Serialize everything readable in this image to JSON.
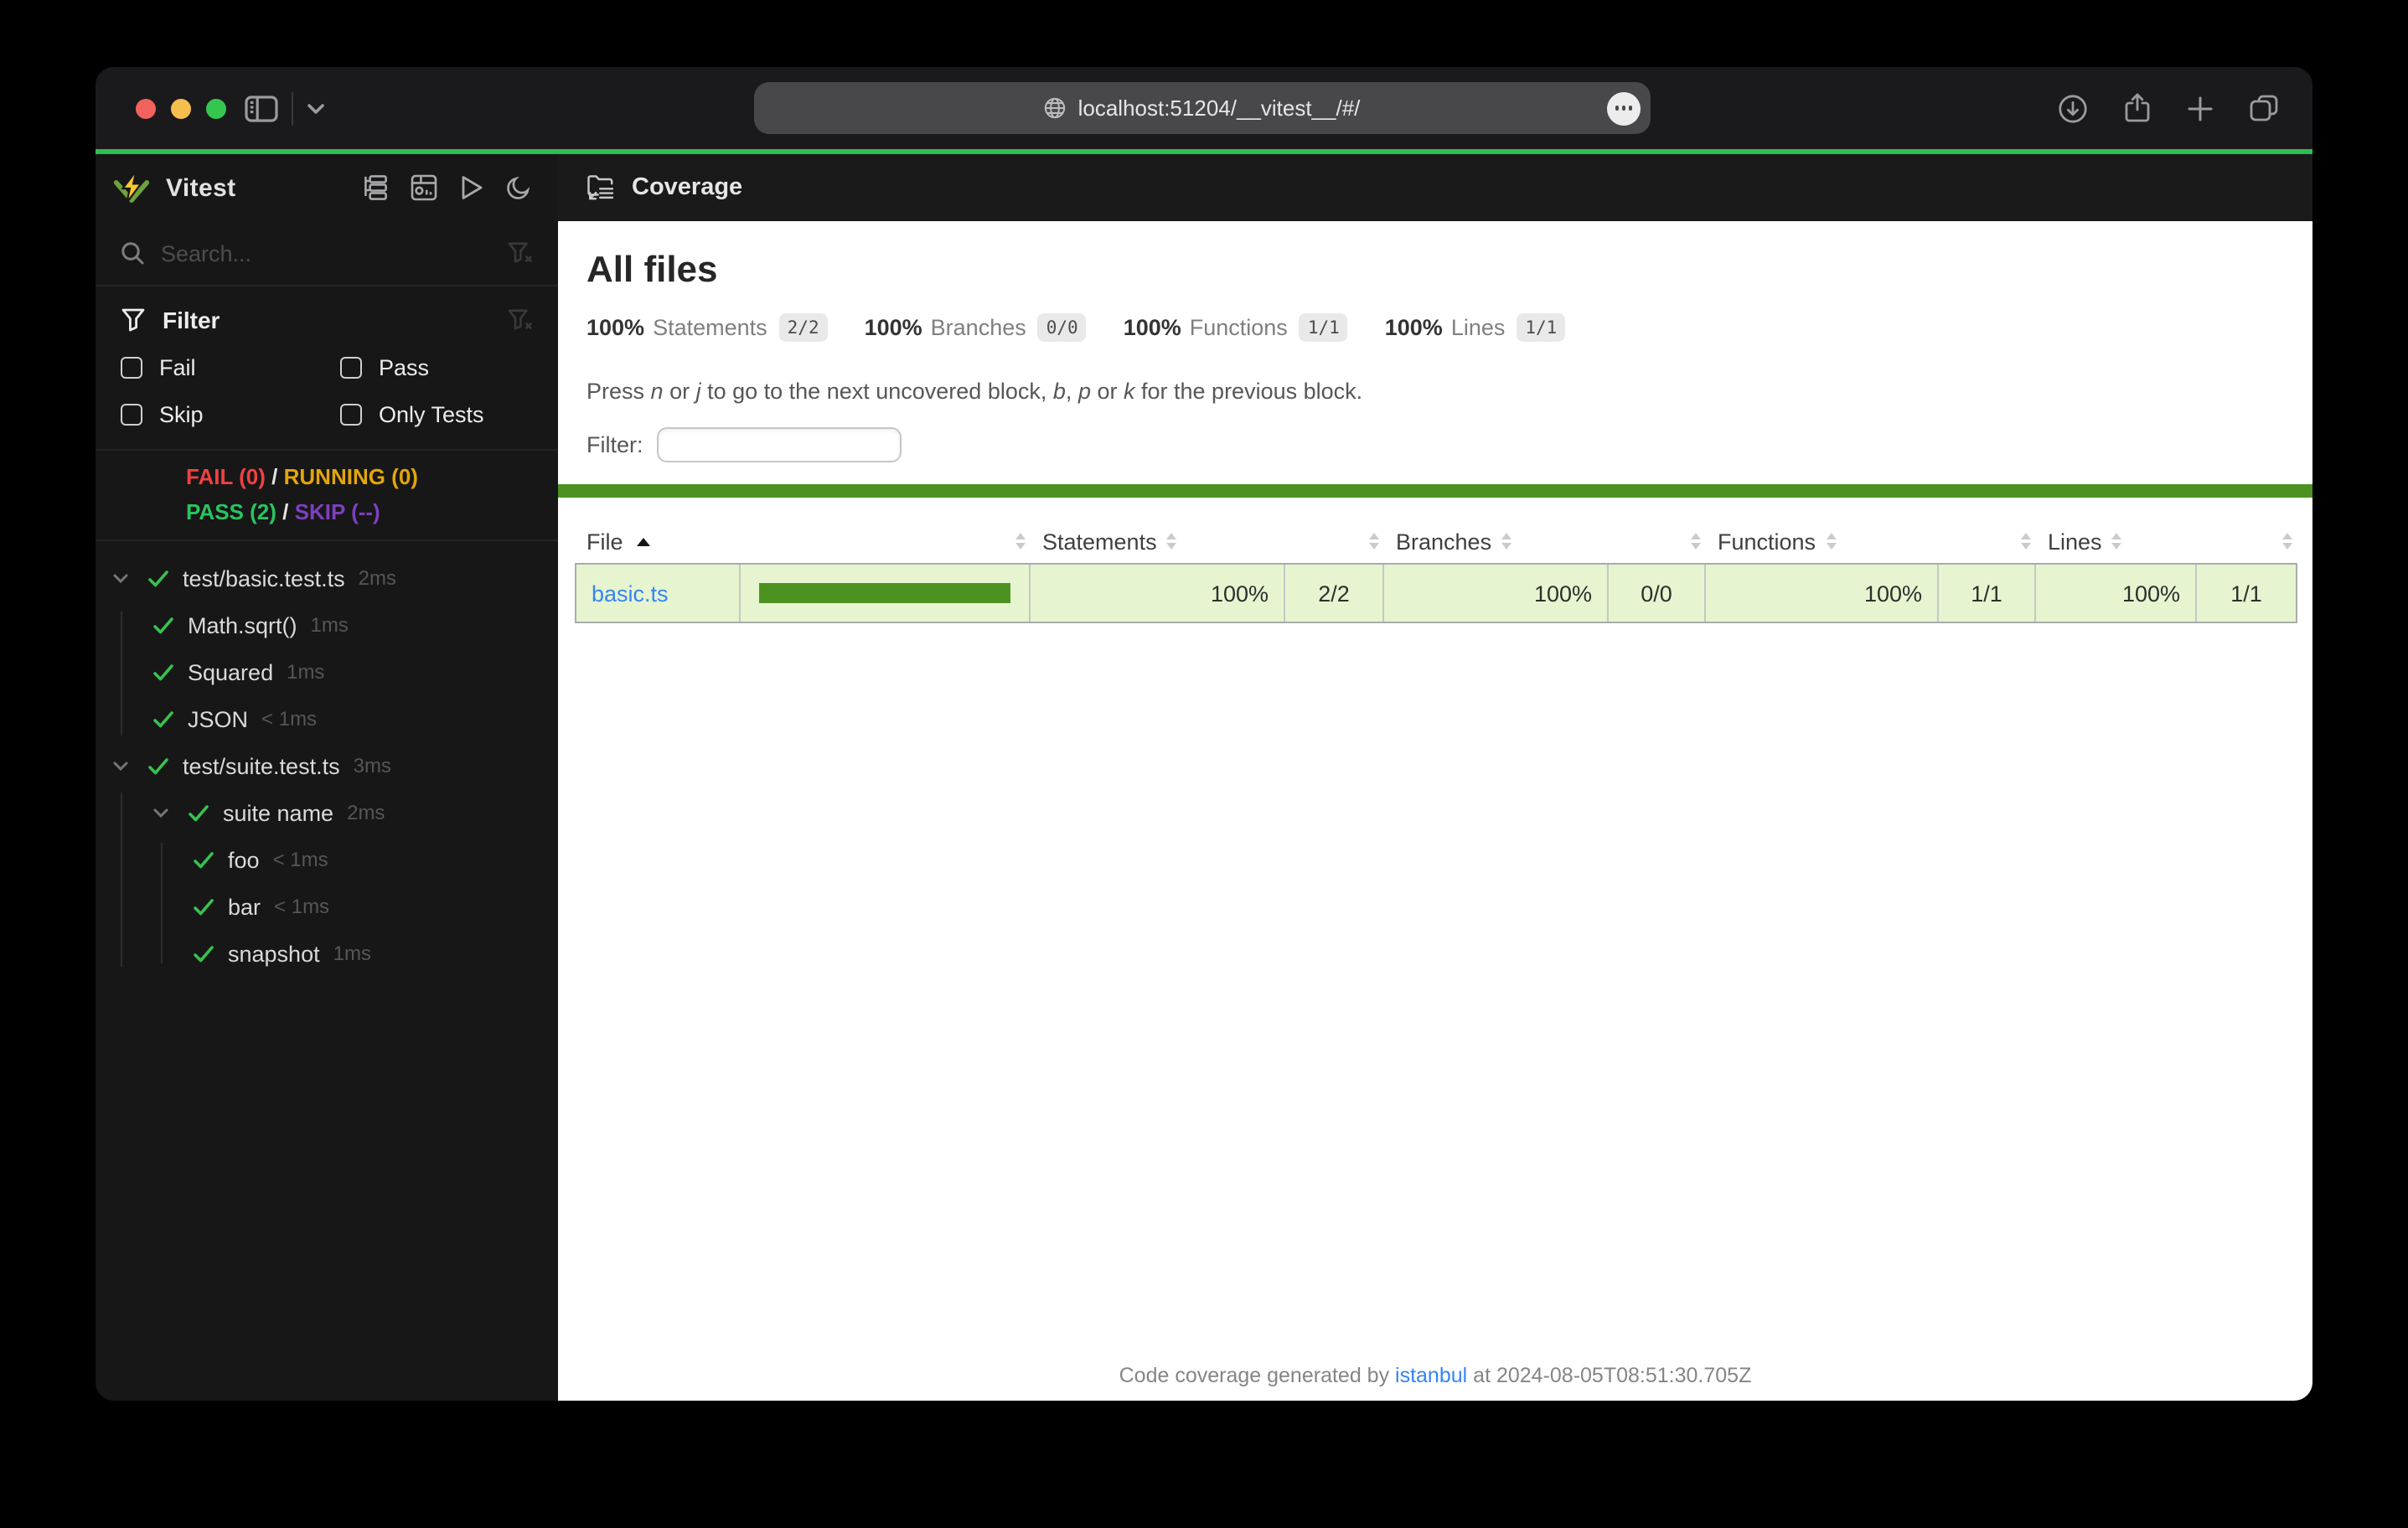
{
  "colors": {
    "traffic_close": "#f0625b",
    "traffic_min": "#f5bf4f",
    "traffic_zoom": "#35c64f",
    "progress_green": "#2dbe50",
    "coverage_green": "#4d9221",
    "coverage_row_bg": "#e6f5d0",
    "link_blue": "#3584f4",
    "fail_red": "#f04141",
    "running_yellow": "#e2a60a",
    "pass_green": "#28c55f",
    "skip_purple": "#7d3fc0"
  },
  "browser": {
    "url": "localhost:51204/__vitest__/#/"
  },
  "sidebar": {
    "title": "Vitest",
    "search_placeholder": "Search...",
    "filter": {
      "title": "Filter",
      "options": [
        {
          "label": "Fail"
        },
        {
          "label": "Pass"
        },
        {
          "label": "Skip"
        },
        {
          "label": "Only Tests"
        }
      ]
    },
    "status": {
      "fail": "FAIL (0)",
      "sep1": "/",
      "running": "RUNNING (0)",
      "pass": "PASS (2)",
      "sep2": "/",
      "skip": "SKIP (--)"
    },
    "tree": [
      {
        "label": "test/basic.test.ts",
        "duration": "2ms"
      },
      {
        "label": "Math.sqrt()",
        "duration": "1ms"
      },
      {
        "label": "Squared",
        "duration": "1ms"
      },
      {
        "label": "JSON",
        "duration": "< 1ms"
      },
      {
        "label": "test/suite.test.ts",
        "duration": "3ms"
      },
      {
        "label": "suite name",
        "duration": "2ms"
      },
      {
        "label": "foo",
        "duration": "< 1ms"
      },
      {
        "label": "bar",
        "duration": "< 1ms"
      },
      {
        "label": "snapshot",
        "duration": "1ms"
      }
    ]
  },
  "main": {
    "header_title": "Coverage",
    "page_title": "All files",
    "stats": [
      {
        "pct": "100%",
        "label": "Statements",
        "frac": "2/2"
      },
      {
        "pct": "100%",
        "label": "Branches",
        "frac": "0/0"
      },
      {
        "pct": "100%",
        "label": "Functions",
        "frac": "1/1"
      },
      {
        "pct": "100%",
        "label": "Lines",
        "frac": "1/1"
      }
    ],
    "hint": {
      "p1": "Press ",
      "k1": "n",
      "p2": " or ",
      "k2": "j",
      "p3": " to go to the next uncovered block, ",
      "k3": "b",
      "p4": ", ",
      "k4": "p",
      "p5": " or ",
      "k5": "k",
      "p6": " for the previous block."
    },
    "filter_label": "Filter:",
    "table": {
      "columns": [
        "File",
        "Statements",
        "Branches",
        "Functions",
        "Lines"
      ],
      "rows": [
        {
          "file": "basic.ts",
          "bar_pct": 100,
          "statements_pct": "100%",
          "statements": "2/2",
          "branches_pct": "100%",
          "branches": "0/0",
          "functions_pct": "100%",
          "functions": "1/1",
          "lines_pct": "100%",
          "lines": "1/1"
        }
      ]
    },
    "footer": {
      "prefix": "Code coverage generated by ",
      "link": "istanbul",
      "suffix": " at 2024-08-05T08:51:30.705Z"
    }
  }
}
